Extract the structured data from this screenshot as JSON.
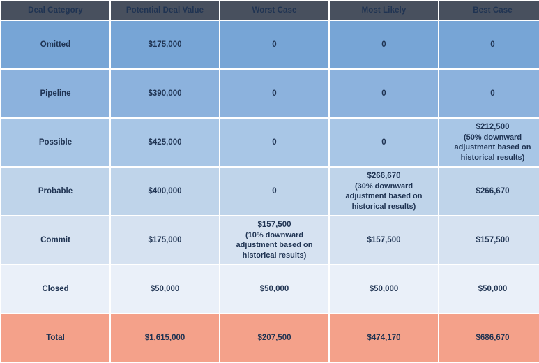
{
  "table": {
    "columns": [
      {
        "key": "category",
        "label": "Deal Category"
      },
      {
        "key": "potential",
        "label": "Potential Deal Value"
      },
      {
        "key": "worst",
        "label": "Worst Case"
      },
      {
        "key": "likely",
        "label": "Most Likely"
      },
      {
        "key": "best",
        "label": "Best Case"
      }
    ],
    "rows": [
      {
        "category": "Omitted",
        "potential": "$175,000",
        "worst": "0",
        "worst_note": "",
        "likely": "0",
        "likely_note": "",
        "best": "0",
        "best_note": ""
      },
      {
        "category": "Pipeline",
        "potential": "$390,000",
        "worst": "0",
        "worst_note": "",
        "likely": "0",
        "likely_note": "",
        "best": "0",
        "best_note": ""
      },
      {
        "category": "Possible",
        "potential": "$425,000",
        "worst": "0",
        "worst_note": "",
        "likely": "0",
        "likely_note": "",
        "best": "$212,500",
        "best_note": "(50% downward adjustment based on historical results)"
      },
      {
        "category": "Probable",
        "potential": "$400,000",
        "worst": "0",
        "worst_note": "",
        "likely": "$266,670",
        "likely_note": "(30% downward adjustment based on historical results)",
        "best": "$266,670",
        "best_note": ""
      },
      {
        "category": "Commit",
        "potential": "$175,000",
        "worst": "$157,500",
        "worst_note": "(10% downward adjustment based on historical results)",
        "likely": "$157,500",
        "likely_note": "",
        "best": "$157,500",
        "best_note": ""
      },
      {
        "category": "Closed",
        "potential": "$50,000",
        "worst": "$50,000",
        "worst_note": "",
        "likely": "$50,000",
        "likely_note": "",
        "best": "$50,000",
        "best_note": ""
      }
    ],
    "total_row": {
      "category": "Total",
      "potential": "$1,615,000",
      "worst": "$207,500",
      "likely": "$474,170",
      "best": "$686,670"
    },
    "colors": {
      "header_bg": "#48505e",
      "header_text": "#ffffff",
      "cell_text": "#1f3352",
      "row_bgs": [
        "#77a5d6",
        "#8cb2dd",
        "#a8c6e6",
        "#bfd4ea",
        "#d6e2f1",
        "#eaf0f9"
      ],
      "total_bg": "#f4a18a",
      "grid_gap": "#ffffff"
    }
  }
}
